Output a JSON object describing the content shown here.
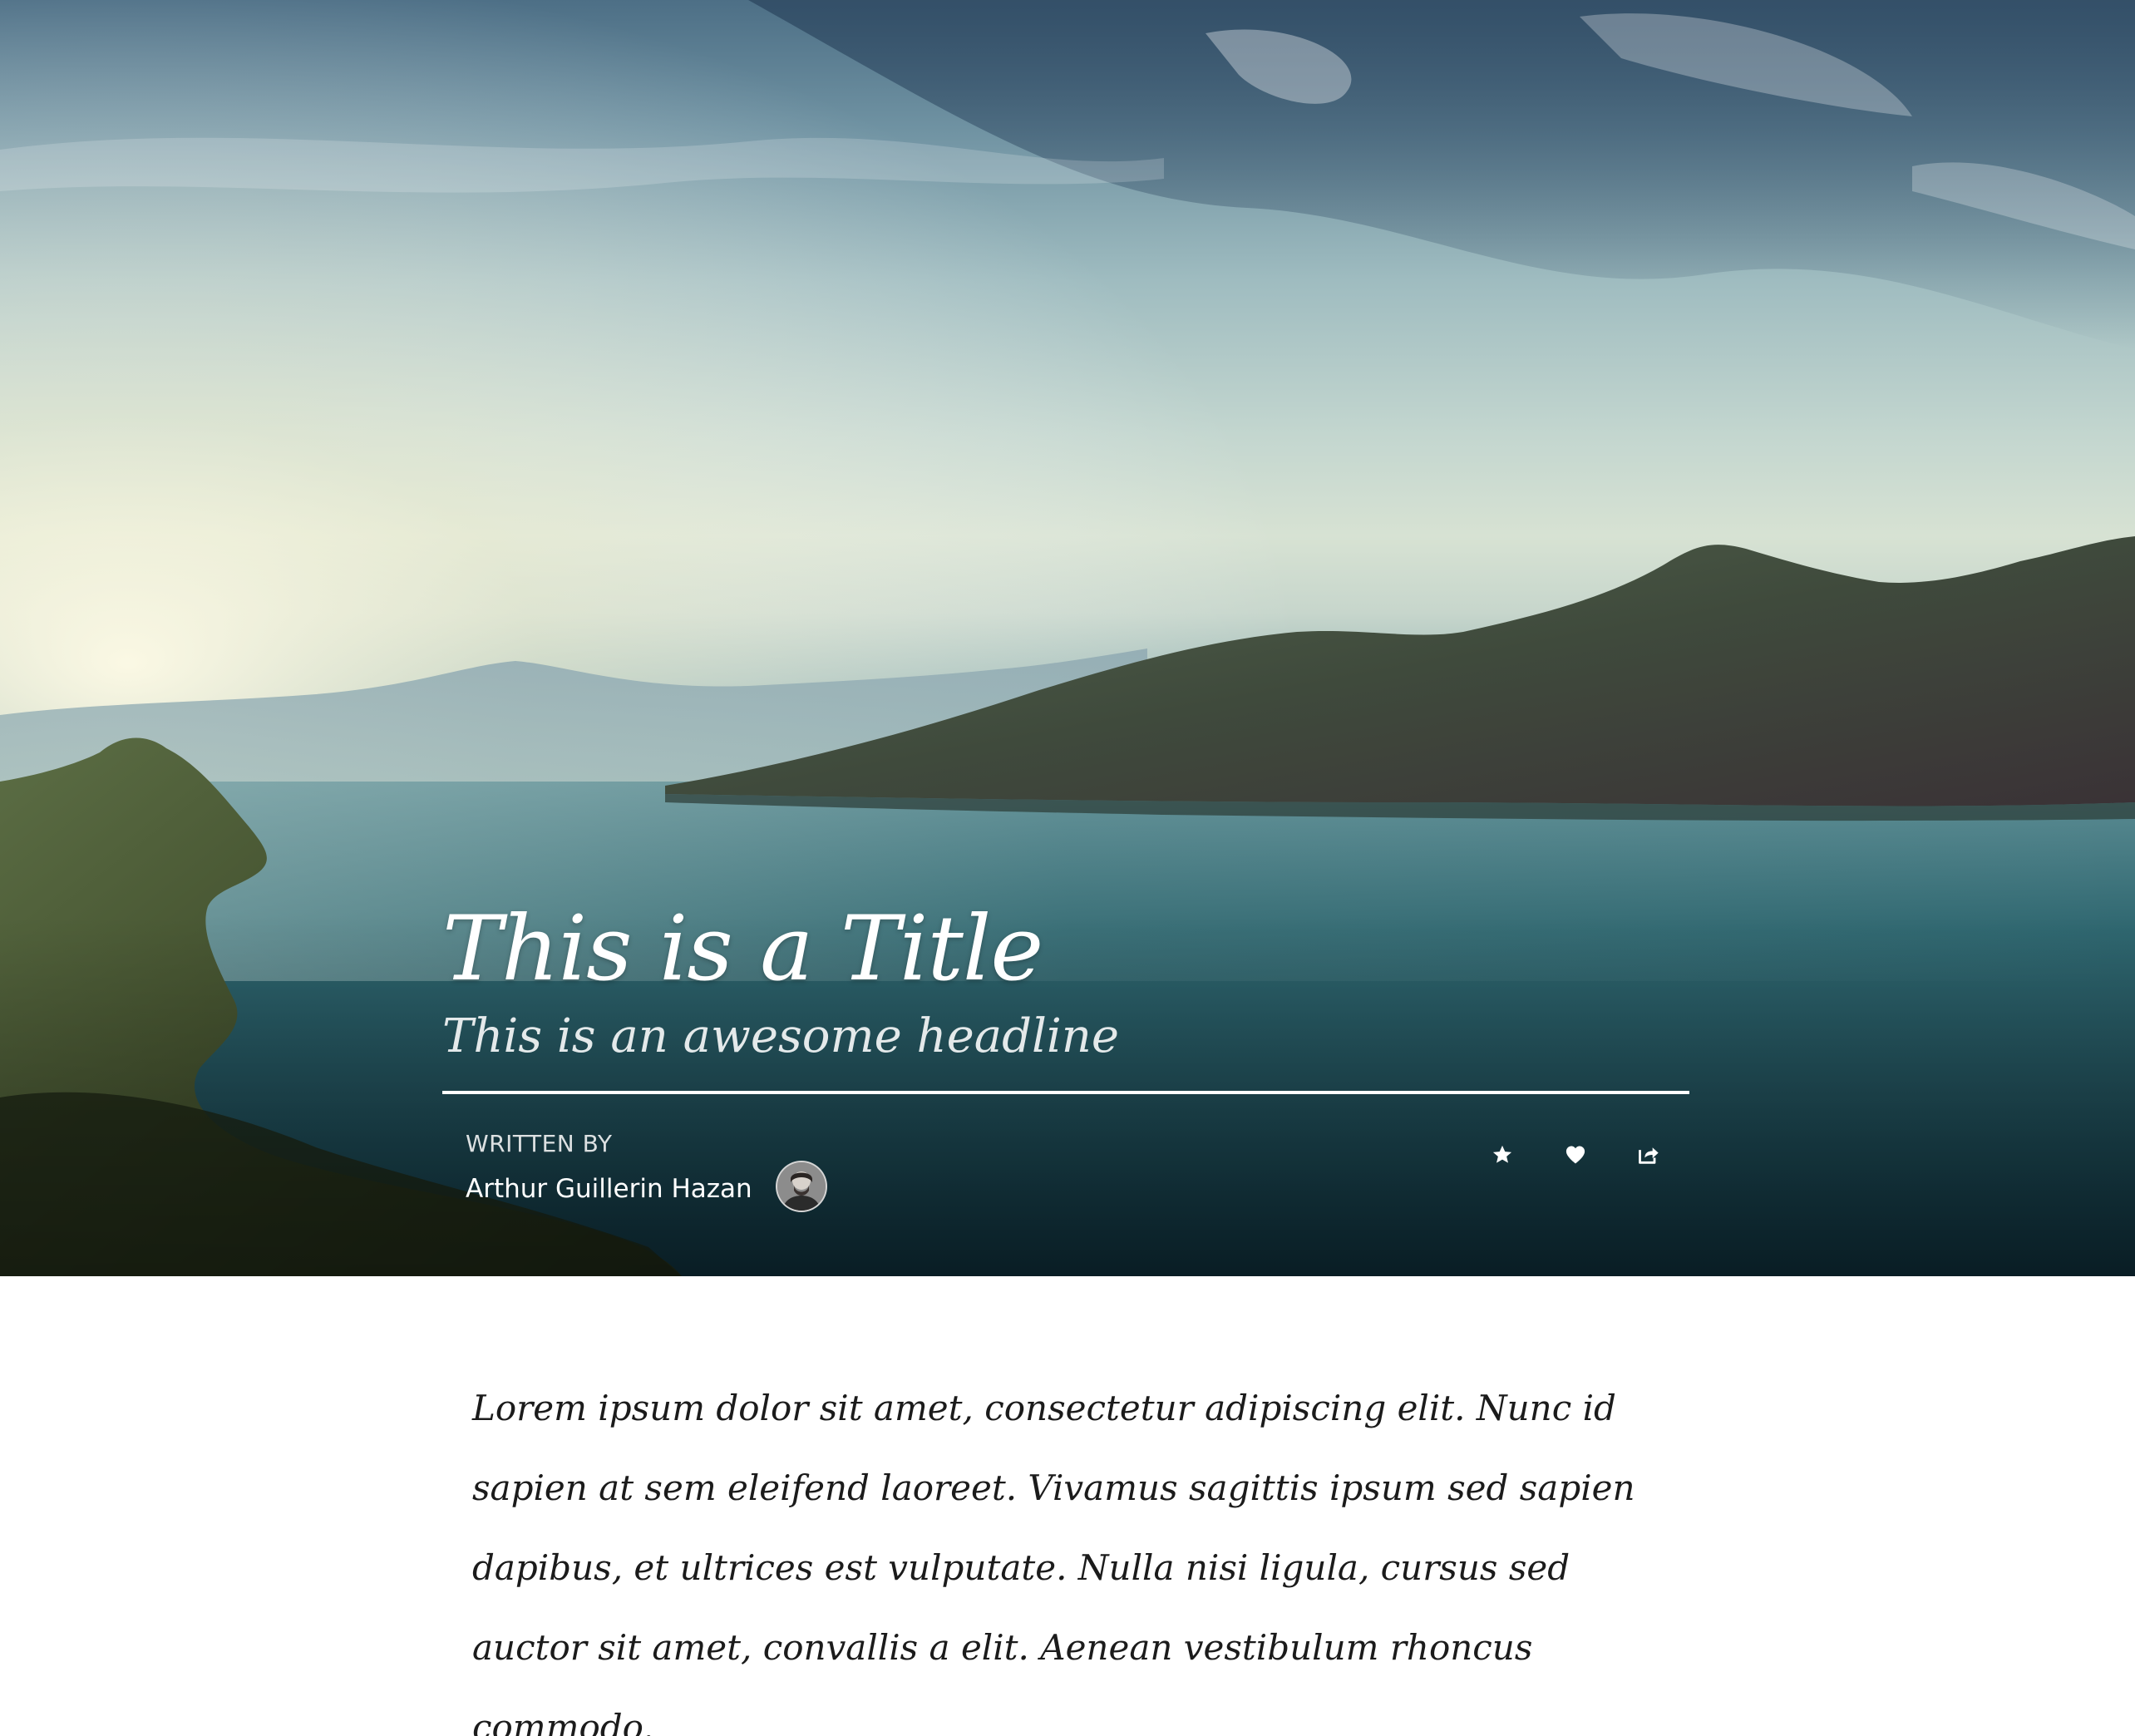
{
  "hero": {
    "title": "This is a Title",
    "subtitle": "This is an awesome headline",
    "author": {
      "written_by_label": "WRITTEN BY",
      "name": "Arthur Guillerin Hazan",
      "avatar_icon": "author-avatar"
    },
    "actions": [
      {
        "name": "favorite",
        "icon": "star-icon"
      },
      {
        "name": "like",
        "icon": "heart-icon"
      },
      {
        "name": "share",
        "icon": "share-icon"
      }
    ]
  },
  "article": {
    "body": "Lorem ipsum dolor sit amet, consectetur adipiscing elit. Nunc id sapien at sem eleifend laoreet. Vivamus sagittis ipsum sed sapien dapibus, et ultrices est vulputate. Nulla nisi ligula, cursus sed auctor sit amet, convallis a elit. Aenean vestibulum rhoncus commodo."
  },
  "colors": {
    "hero_text": "#ffffff",
    "body_text": "#1b1b1b",
    "background": "#ffffff"
  }
}
